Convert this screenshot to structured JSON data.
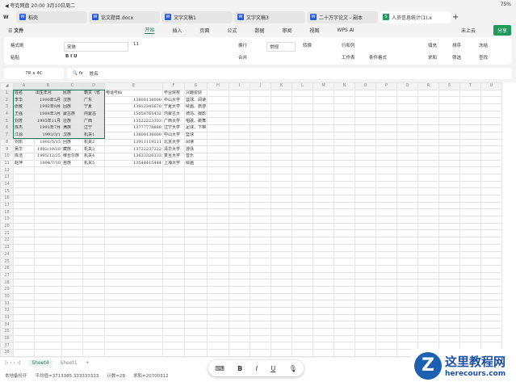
{
  "status": {
    "left": "◀ 夸克网盘  20:00  3月10日周二",
    "battery": "75%"
  },
  "tabs": [
    {
      "label": "稻壳",
      "icon": "W"
    },
    {
      "label": "论文题目.docx",
      "icon": "W"
    },
    {
      "label": "文字文稿1",
      "icon": "W"
    },
    {
      "label": "文字文稿3",
      "icon": "W"
    },
    {
      "label": "二十万字论文 - 副本",
      "icon": "W"
    },
    {
      "label": "人员信息统计(1).x",
      "icon": "S"
    }
  ],
  "menu": {
    "file": "文件",
    "items": [
      "开始",
      "插入",
      "页面",
      "公式",
      "数据",
      "审阅",
      "视图",
      "WPS AI"
    ],
    "upload": "未上云",
    "share": "分享"
  },
  "ribbon": {
    "format_painter": "格式刷",
    "paste": "粘贴",
    "font": "宋体",
    "size": "11",
    "wrap": "换行",
    "merge": "合并",
    "number_format": "常规",
    "convert": "转换",
    "rowcol": "行和列",
    "worksheet": "工作表",
    "cond_format": "条件格式",
    "fill": "填充",
    "sort": "排序",
    "freeze": "冻结",
    "sum": "求和",
    "filter": "筛选",
    "find": "查找"
  },
  "formula": {
    "namebox": "7R x 4C",
    "value": "姓名"
  },
  "columns": [
    "A",
    "B",
    "C",
    "D",
    "E",
    "F",
    "G",
    "H",
    "I",
    "J",
    "K",
    "L",
    "M",
    "N",
    "O",
    "P",
    "Q",
    "R",
    "S",
    "T",
    "U"
  ],
  "rows": [
    [
      "姓名",
      "出生年月",
      "民族",
      "籍贯（省",
      "电话号码",
      "毕业院校",
      "兴趣爱好"
    ],
    [
      "李华",
      "1990年5月",
      "汉族",
      "广东",
      "13800138000",
      "中山大学",
      "篮球、阅读"
    ],
    [
      "张敏",
      "1992年8月",
      "回族",
      "宁夏",
      "13912345678",
      "宁夏大学",
      "绘画、旅游"
    ],
    [
      "王强",
      "1988年3月",
      "蒙古族",
      "内蒙古",
      "15058765432",
      "内蒙古大",
      "骑马、摄影"
    ],
    [
      "刘芳",
      "1995年11月",
      "壮族",
      "广西",
      "13522223333",
      "广西大学",
      "唱歌、跳舞"
    ],
    [
      "陈杰",
      "1991年7月",
      "满族",
      "辽宁",
      "13777778888",
      "辽宁大学",
      "足球、下棋"
    ],
    [
      "江源",
      "1993/3/1",
      "汉族",
      "机关1",
      "13800138000",
      "中山大学",
      "篮球"
    ],
    [
      "刘凯",
      "1991/5/15",
      "回族",
      "机关2",
      "13911119111",
      "北京大学",
      "阅读"
    ],
    [
      "吴华",
      "1992/10/20",
      "藏族",
      "机关3",
      "13722237222",
      "清华大学",
      "游泳"
    ],
    [
      "陈洁",
      "1995/12/25",
      "维吾尔族",
      "机关4",
      "13633326333",
      "复旦大学",
      "音乐"
    ],
    [
      "赵萍",
      "1994/7/10",
      "苗族",
      "机关5",
      "13544415444",
      "上海大学",
      "绘画"
    ]
  ],
  "sheets": [
    "Sheet4",
    "Sheet1"
  ],
  "statusbar": {
    "backup": "本地备份开",
    "avg": "平均值=3713385.333333333",
    "count": "计数=28",
    "sum": "求和=20700312"
  },
  "format_bar": [
    "B",
    "I",
    "U"
  ],
  "watermark": {
    "title": "这里教程网",
    "url": "herecours.com"
  }
}
